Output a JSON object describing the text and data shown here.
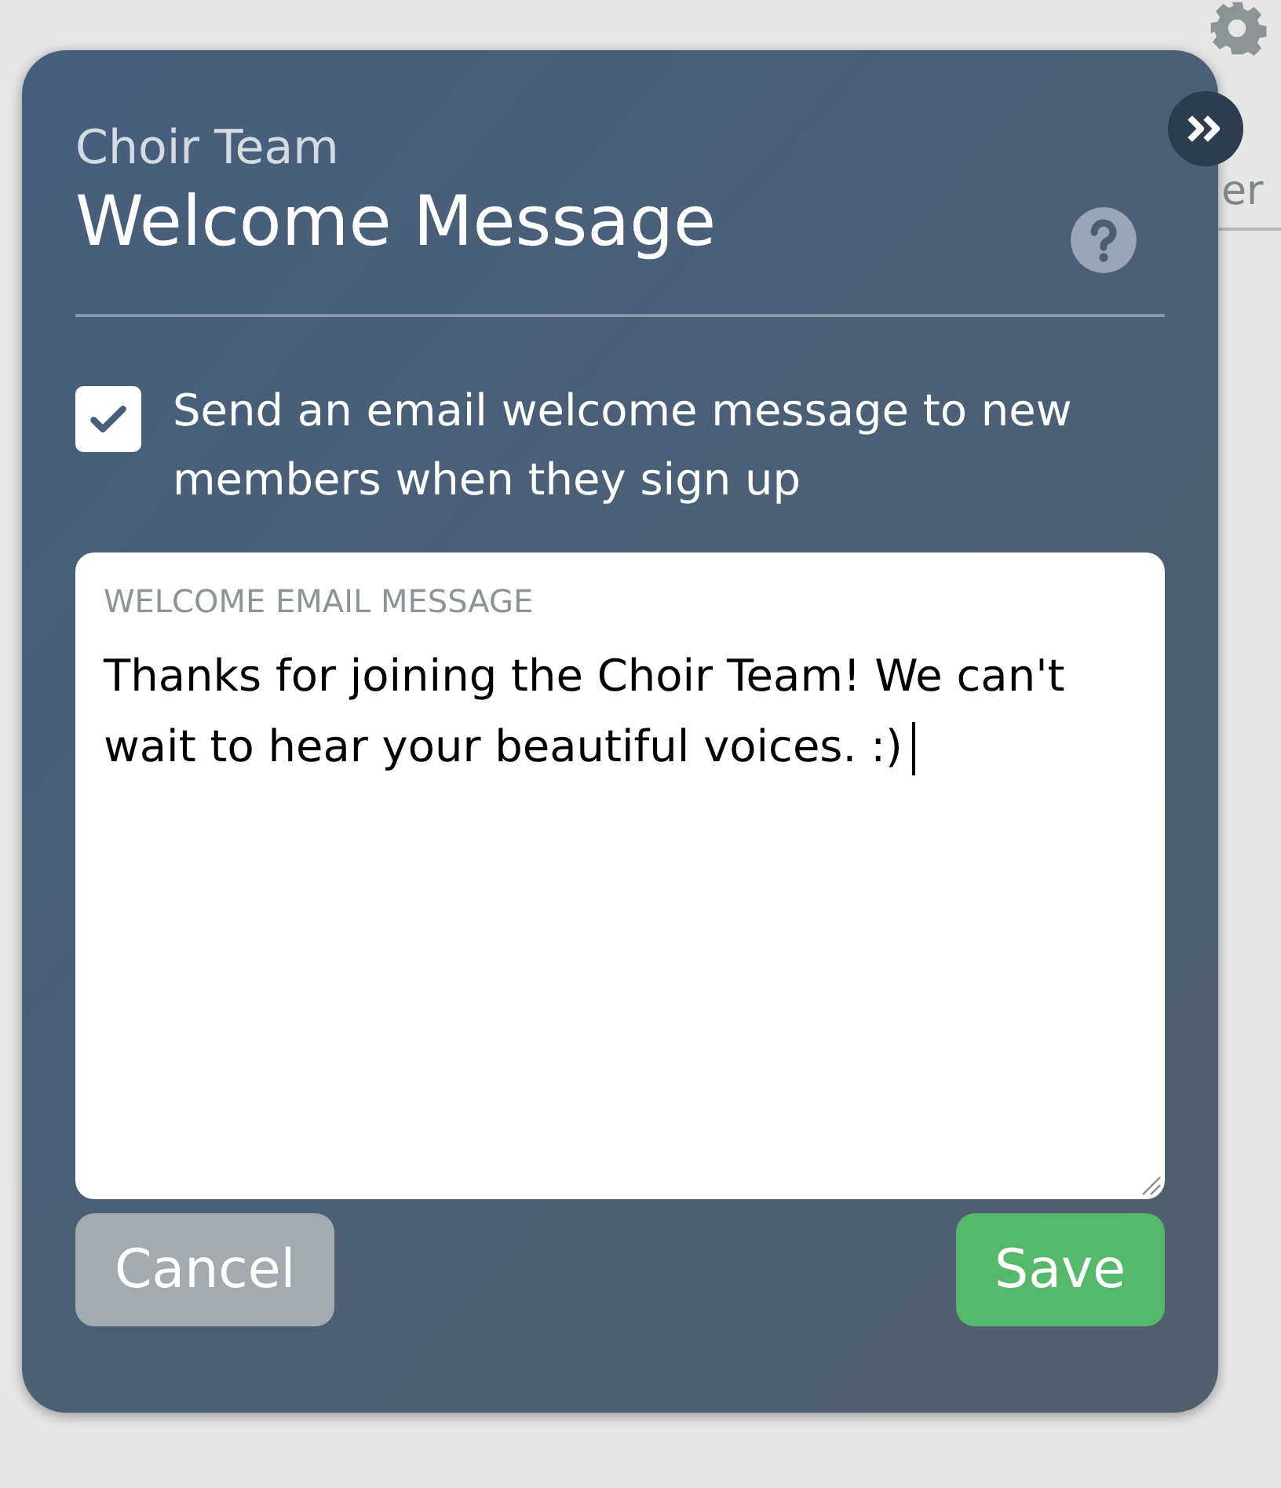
{
  "background": {
    "partial_label": "er"
  },
  "dialog": {
    "subtitle": "Choir Team",
    "title": "Welcome Message",
    "send_email": {
      "label": "Send an email welcome message to new members when they sign up",
      "checked": true
    },
    "message": {
      "label": "WELCOME EMAIL MESSAGE",
      "value": "Thanks for joining the Choir Team! We can't wait to hear your beautiful voices. :)"
    },
    "buttons": [
      {
        "kind": "cancel",
        "label": "Cancel"
      },
      {
        "kind": "save",
        "label": "Save"
      }
    ]
  }
}
